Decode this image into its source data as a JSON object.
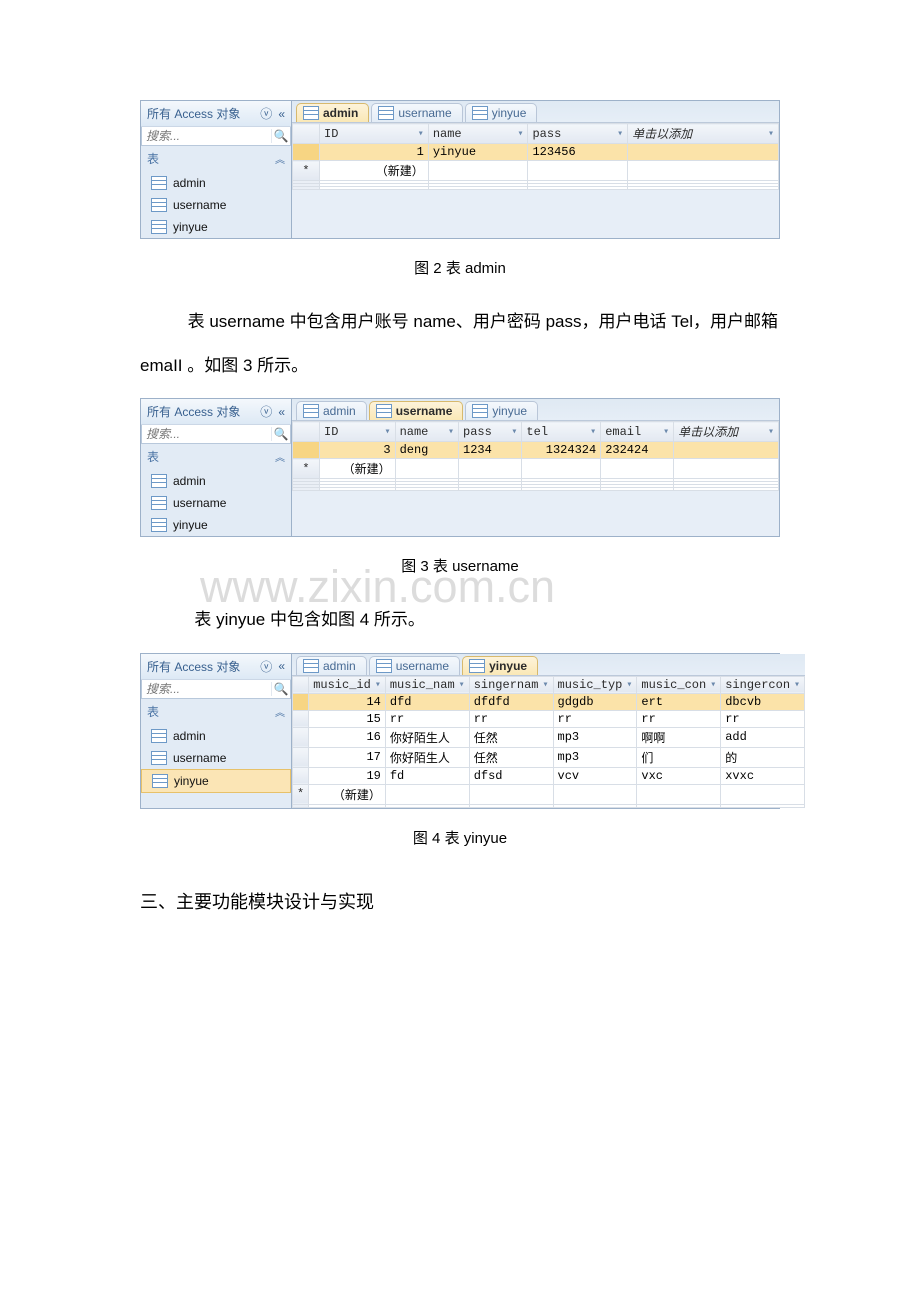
{
  "nav": {
    "title": "所有 Access 对象",
    "search_placeholder": "搜索...",
    "group": "表",
    "items": [
      "admin",
      "username",
      "yinyue"
    ]
  },
  "figure2": {
    "tabs": [
      "admin",
      "username",
      "yinyue"
    ],
    "active_tab": "admin",
    "columns": [
      "ID",
      "name",
      "pass"
    ],
    "add_col": "单击以添加",
    "rows": [
      {
        "ID": "1",
        "name": "yinyue",
        "pass": "123456"
      }
    ],
    "new_row": "（新建）",
    "caption": "图 2 表 admin"
  },
  "para1": "表 username 中包含用户账号 name、用户密码 pass，用户电话 Tel，用户邮箱 emaII 。如图 3 所示。",
  "figure3": {
    "tabs": [
      "admin",
      "username",
      "yinyue"
    ],
    "active_tab": "username",
    "columns": [
      "ID",
      "name",
      "pass",
      "tel",
      "email"
    ],
    "add_col": "单击以添加",
    "rows": [
      {
        "ID": "3",
        "name": "deng",
        "pass": "1234",
        "tel": "1324324",
        "email": "232424"
      }
    ],
    "new_row": "（新建）",
    "caption": "图 3 表 username"
  },
  "watermark": "www.zixin.com.cn",
  "para2": "表 yinyue 中包含如图 4 所示。",
  "figure4": {
    "tabs": [
      "admin",
      "username",
      "yinyue"
    ],
    "active_tab": "yinyue",
    "columns": [
      "music_id",
      "music_nam",
      "singernam",
      "music_typ",
      "music_con",
      "singercon"
    ],
    "rows": [
      {
        "c": [
          "14",
          "dfd",
          "dfdfd",
          "gdgdb",
          "ert",
          "dbcvb"
        ]
      },
      {
        "c": [
          "15",
          "rr",
          "rr",
          "rr",
          "rr",
          "rr"
        ]
      },
      {
        "c": [
          "16",
          "你好陌生人",
          "任然",
          "mp3",
          "啊啊",
          "add"
        ]
      },
      {
        "c": [
          "17",
          "你好陌生人",
          "任然",
          "mp3",
          "们",
          "的"
        ]
      },
      {
        "c": [
          "19",
          "fd",
          "dfsd",
          "vcv",
          "vxc",
          "xvxc"
        ]
      }
    ],
    "new_row": "（新建）",
    "caption": "图 4 表 yinyue"
  },
  "section3": "三、主要功能模块设计与实现"
}
